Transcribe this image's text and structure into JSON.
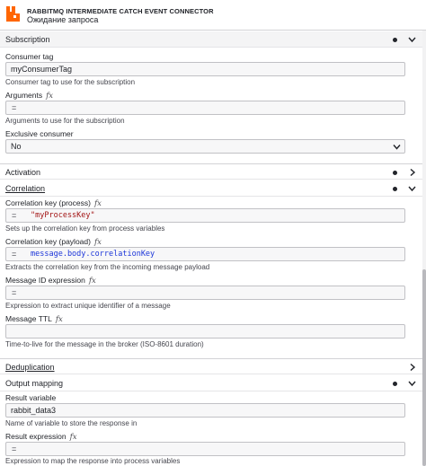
{
  "header": {
    "element_type": "RABBITMQ INTERMEDIATE CATCH EVENT CONNECTOR",
    "element_name": "Ожидание запроса",
    "icon": "rabbitmq-logo",
    "accent_color": "#ff6600"
  },
  "groups": {
    "subscription": {
      "title": "Subscription",
      "consumer_tag": {
        "label": "Consumer tag",
        "value": "myConsumerTag",
        "description": "Consumer tag to use for the subscription"
      },
      "arguments": {
        "label": "Arguments",
        "fx": "fx",
        "eq": "=",
        "value": "",
        "description": "Arguments to use for the subscription"
      },
      "exclusive_consumer": {
        "label": "Exclusive consumer",
        "value": "No"
      }
    },
    "activation": {
      "title": "Activation"
    },
    "correlation": {
      "title": "Correlation",
      "key_process": {
        "label": "Correlation key (process)",
        "fx": "fx",
        "eq": "=",
        "value": "\"myProcessKey\"",
        "description": "Sets up the correlation key from process variables"
      },
      "key_payload": {
        "label": "Correlation key (payload)",
        "fx": "fx",
        "eq": "=",
        "value": "message.body.correlationKey",
        "description": "Extracts the correlation key from the incoming message payload"
      },
      "message_id": {
        "label": "Message ID expression",
        "fx": "fx",
        "eq": "=",
        "value": "",
        "description": "Expression to extract unique identifier of a message"
      },
      "message_ttl": {
        "label": "Message TTL",
        "fx": "fx",
        "value": "",
        "description": "Time-to-live for the message in the broker (ISO-8601 duration)"
      }
    },
    "deduplication": {
      "title": "Deduplication"
    },
    "output_mapping": {
      "title": "Output mapping",
      "result_variable": {
        "label": "Result variable",
        "value": "rabbit_data3",
        "description": "Name of variable to store the response in"
      },
      "result_expression": {
        "label": "Result expression",
        "fx": "fx",
        "eq": "=",
        "value": "",
        "description": "Expression to map the response into process variables"
      }
    }
  }
}
